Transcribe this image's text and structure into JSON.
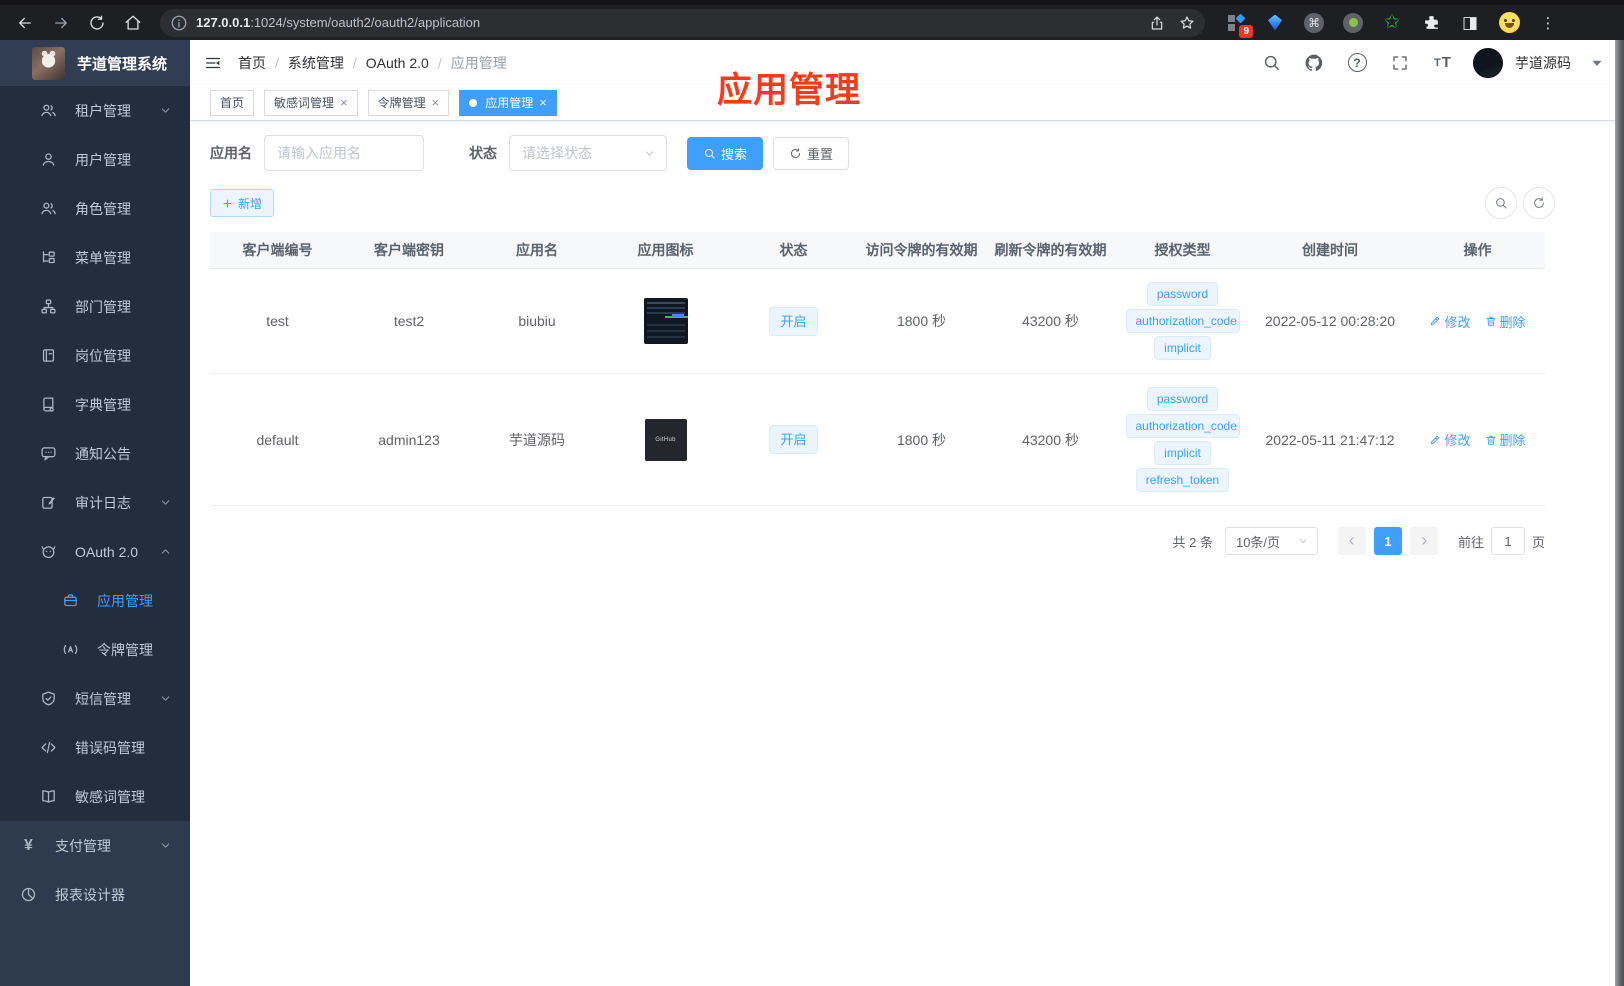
{
  "colors": {
    "accent": "#409eff",
    "annotation_red": "#fb3a1d",
    "sidebar_bg": "#2e3b4e",
    "sidebar_submenu_bg": "#222e3e",
    "tag_bg": "#ecf5ff"
  },
  "browser": {
    "url_host": "127.0.0.1",
    "url_rest": ":1024/system/oauth2/oauth2/application",
    "extension_badge": "9",
    "icons": [
      "back-icon",
      "forward-icon",
      "reload-icon",
      "home-icon",
      "info-icon",
      "share-icon",
      "star-icon",
      "blocks-extension-icon",
      "gem-extension-icon",
      "command-extension-icon",
      "record-extension-icon",
      "green-star-extension-icon",
      "puzzle-icon",
      "split-view-icon",
      "emoji-avatar-icon",
      "kebab-menu-icon"
    ]
  },
  "sidebar": {
    "logo_title": "芋道管理系统",
    "items": [
      {
        "label": "租户管理",
        "icon": "users-icon",
        "arrow": "down"
      },
      {
        "label": "用户管理",
        "icon": "user-icon"
      },
      {
        "label": "角色管理",
        "icon": "users-icon"
      },
      {
        "label": "菜单管理",
        "icon": "menu-tree-icon"
      },
      {
        "label": "部门管理",
        "icon": "org-chart-icon"
      },
      {
        "label": "岗位管理",
        "icon": "badge-icon"
      },
      {
        "label": "字典管理",
        "icon": "dictionary-icon"
      },
      {
        "label": "通知公告",
        "icon": "announcement-icon"
      },
      {
        "label": "审计日志",
        "icon": "audit-log-icon",
        "arrow": "down"
      },
      {
        "label": "OAuth 2.0",
        "icon": "robot-icon",
        "arrow": "up"
      },
      {
        "label": "应用管理",
        "icon": "briefcase-icon",
        "active": true
      },
      {
        "label": "令牌管理",
        "icon": "token-icon"
      },
      {
        "label": "短信管理",
        "icon": "shield-icon",
        "arrow": "down"
      },
      {
        "label": "错误码管理",
        "icon": "code-icon"
      },
      {
        "label": "敏感词管理",
        "icon": "book-open-icon"
      },
      {
        "label": "支付管理",
        "icon": "yen-icon",
        "arrow": "down"
      },
      {
        "label": "报表设计器",
        "icon": "report-icon"
      }
    ]
  },
  "header": {
    "breadcrumb": [
      "首页",
      "系统管理",
      "OAuth 2.0",
      "应用管理"
    ],
    "username": "芋道源码",
    "icons": [
      "search-icon",
      "github-icon",
      "help-icon",
      "fullscreen-icon",
      "font-size-icon",
      "avatar",
      "caret-down-icon"
    ]
  },
  "tabs": [
    {
      "label": "首页",
      "closable": false,
      "active": false
    },
    {
      "label": "敏感词管理",
      "closable": true,
      "active": false
    },
    {
      "label": "令牌管理",
      "closable": true,
      "active": false
    },
    {
      "label": "应用管理",
      "closable": true,
      "active": true
    }
  ],
  "annotation": {
    "text": "应用管理"
  },
  "filter": {
    "name_label": "应用名",
    "name_placeholder": "请输入应用名",
    "status_label": "状态",
    "status_placeholder": "请选择状态",
    "search_label": "搜索",
    "reset_label": "重置"
  },
  "toolbar": {
    "add_label": "新增"
  },
  "table": {
    "headers": [
      "客户端编号",
      "客户端密钥",
      "应用名",
      "应用图标",
      "状态",
      "访问令牌的有效期",
      "刷新令牌的有效期",
      "授权类型",
      "创建时间",
      "操作"
    ],
    "actions": {
      "edit": "修改",
      "delete": "删除"
    },
    "rows": [
      {
        "client_id": "test",
        "secret": "test2",
        "name": "biubiu",
        "icon": "dark-dashboard-screenshot",
        "status": "开启",
        "access_token_ttl": "1800 秒",
        "refresh_token_ttl": "43200 秒",
        "grant_types": [
          "password",
          "authorization_code",
          "implicit"
        ],
        "created": "2022-05-12 00:28:20"
      },
      {
        "client_id": "default",
        "secret": "admin123",
        "name": "芋道源码",
        "icon": "github-dark-logo",
        "icon_text": "GitHub",
        "status": "开启",
        "access_token_ttl": "1800 秒",
        "refresh_token_ttl": "43200 秒",
        "grant_types": [
          "password",
          "authorization_code",
          "implicit",
          "refresh_token"
        ],
        "created": "2022-05-11 21:47:12"
      }
    ]
  },
  "pagination": {
    "total": "共 2 条",
    "page_size": "10条/页",
    "current_page": "1",
    "goto_prefix": "前往",
    "goto_value": "1",
    "goto_suffix": "页"
  }
}
